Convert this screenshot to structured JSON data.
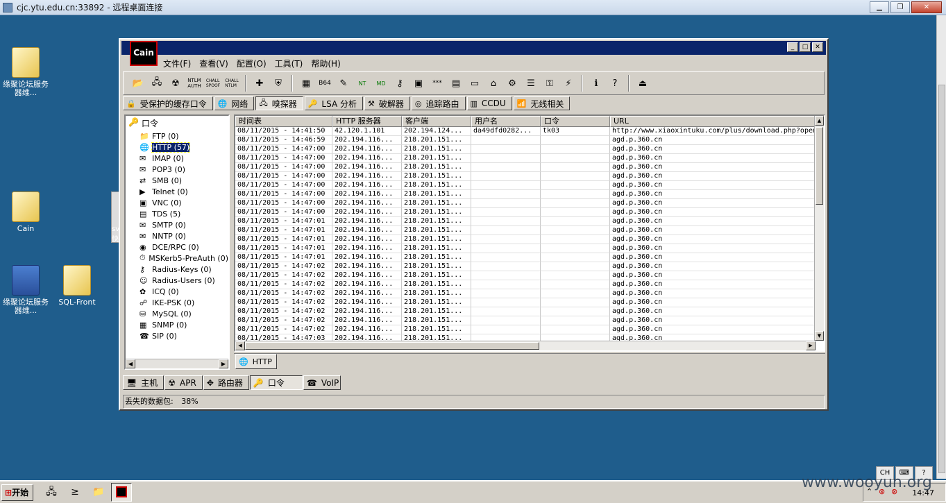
{
  "rdp": {
    "title": "cjc.ytu.edu.cn:33892 - 远程桌面连接"
  },
  "desktop": {
    "icons": [
      {
        "label": "缘聚论坛服务器维..."
      },
      {
        "label": "Cain"
      },
      {
        "label": "缘聚论坛服务器维..."
      },
      {
        "label": "SQL-Front"
      }
    ],
    "partial_label": "sv\n快"
  },
  "cain": {
    "logo": "Cain",
    "menu": [
      "文件(F)",
      "查看(V)",
      "配置(O)",
      "工具(T)",
      "帮助(H)"
    ],
    "tabs": [
      "受保护的缓存口令",
      "网络",
      "嗅探器",
      "LSA 分析",
      "破解器",
      "追踪路由",
      "CCDU",
      "无线相关"
    ],
    "selected_tab": "嗅探器",
    "tree_root": "口令",
    "tree": [
      {
        "label": "FTP  (0)",
        "icon": "ftp-icon"
      },
      {
        "label": "HTTP (57)",
        "icon": "http-icon",
        "selected": true
      },
      {
        "label": "IMAP (0)",
        "icon": "imap-icon"
      },
      {
        "label": "POP3 (0)",
        "icon": "pop3-icon"
      },
      {
        "label": "SMB  (0)",
        "icon": "smb-icon"
      },
      {
        "label": "Telnet (0)",
        "icon": "telnet-icon"
      },
      {
        "label": "VNC  (0)",
        "icon": "vnc-icon"
      },
      {
        "label": "TDS  (5)",
        "icon": "tds-icon"
      },
      {
        "label": "SMTP (0)",
        "icon": "smtp-icon"
      },
      {
        "label": "NNTP (0)",
        "icon": "nntp-icon"
      },
      {
        "label": "DCE/RPC (0)",
        "icon": "dcerpc-icon"
      },
      {
        "label": "MSKerb5-PreAuth (0)",
        "icon": "kerberos-icon"
      },
      {
        "label": "Radius-Keys (0)",
        "icon": "radius-keys-icon"
      },
      {
        "label": "Radius-Users (0)",
        "icon": "radius-users-icon"
      },
      {
        "label": "ICQ  (0)",
        "icon": "icq-icon"
      },
      {
        "label": "IKE-PSK (0)",
        "icon": "ike-icon"
      },
      {
        "label": "MySQL (0)",
        "icon": "mysql-icon"
      },
      {
        "label": "SNMP (0)",
        "icon": "snmp-icon"
      },
      {
        "label": "SIP  (0)",
        "icon": "sip-icon"
      }
    ],
    "columns": [
      "时间表",
      "HTTP 服务器",
      "客户端",
      "用户名",
      "口令",
      "URL"
    ],
    "rows": [
      [
        "08/11/2015 - 14:41:50",
        "42.120.1.101",
        "202.194.124...",
        "da49dfd0282...",
        "tk03",
        "http://www.xiaoxintuku.com/plus/download.php?open"
      ],
      [
        "08/11/2015 - 14:46:59",
        "202.194.116...",
        "218.201.151...",
        "",
        "",
        "agd.p.360.cn"
      ],
      [
        "08/11/2015 - 14:47:00",
        "202.194.116...",
        "218.201.151...",
        "",
        "",
        "agd.p.360.cn"
      ],
      [
        "08/11/2015 - 14:47:00",
        "202.194.116...",
        "218.201.151...",
        "",
        "",
        "agd.p.360.cn"
      ],
      [
        "08/11/2015 - 14:47:00",
        "202.194.116...",
        "218.201.151...",
        "",
        "",
        "agd.p.360.cn"
      ],
      [
        "08/11/2015 - 14:47:00",
        "202.194.116...",
        "218.201.151...",
        "",
        "",
        "agd.p.360.cn"
      ],
      [
        "08/11/2015 - 14:47:00",
        "202.194.116...",
        "218.201.151...",
        "",
        "",
        "agd.p.360.cn"
      ],
      [
        "08/11/2015 - 14:47:00",
        "202.194.116...",
        "218.201.151...",
        "",
        "",
        "agd.p.360.cn"
      ],
      [
        "08/11/2015 - 14:47:00",
        "202.194.116...",
        "218.201.151...",
        "",
        "",
        "agd.p.360.cn"
      ],
      [
        "08/11/2015 - 14:47:00",
        "202.194.116...",
        "218.201.151...",
        "",
        "",
        "agd.p.360.cn"
      ],
      [
        "08/11/2015 - 14:47:01",
        "202.194.116...",
        "218.201.151...",
        "",
        "",
        "agd.p.360.cn"
      ],
      [
        "08/11/2015 - 14:47:01",
        "202.194.116...",
        "218.201.151...",
        "",
        "",
        "agd.p.360.cn"
      ],
      [
        "08/11/2015 - 14:47:01",
        "202.194.116...",
        "218.201.151...",
        "",
        "",
        "agd.p.360.cn"
      ],
      [
        "08/11/2015 - 14:47:01",
        "202.194.116...",
        "218.201.151...",
        "",
        "",
        "agd.p.360.cn"
      ],
      [
        "08/11/2015 - 14:47:01",
        "202.194.116...",
        "218.201.151...",
        "",
        "",
        "agd.p.360.cn"
      ],
      [
        "08/11/2015 - 14:47:02",
        "202.194.116...",
        "218.201.151...",
        "",
        "",
        "agd.p.360.cn"
      ],
      [
        "08/11/2015 - 14:47:02",
        "202.194.116...",
        "218.201.151...",
        "",
        "",
        "agd.p.360.cn"
      ],
      [
        "08/11/2015 - 14:47:02",
        "202.194.116...",
        "218.201.151...",
        "",
        "",
        "agd.p.360.cn"
      ],
      [
        "08/11/2015 - 14:47:02",
        "202.194.116...",
        "218.201.151...",
        "",
        "",
        "agd.p.360.cn"
      ],
      [
        "08/11/2015 - 14:47:02",
        "202.194.116...",
        "218.201.151...",
        "",
        "",
        "agd.p.360.cn"
      ],
      [
        "08/11/2015 - 14:47:02",
        "202.194.116...",
        "218.201.151...",
        "",
        "",
        "agd.p.360.cn"
      ],
      [
        "08/11/2015 - 14:47:02",
        "202.194.116...",
        "218.201.151...",
        "",
        "",
        "agd.p.360.cn"
      ],
      [
        "08/11/2015 - 14:47:02",
        "202.194.116...",
        "218.201.151...",
        "",
        "",
        "agd.p.360.cn"
      ],
      [
        "08/11/2015 - 14:47:03",
        "202.194.116...",
        "218.201.151...",
        "",
        "",
        "agd.p.360.cn"
      ]
    ],
    "subtab": "HTTP",
    "bottom_tabs": [
      "主机",
      "APR",
      "路由器",
      "口令",
      "VoIP"
    ],
    "status_label": "丢失的数据包:",
    "status_value": "38%"
  },
  "taskbar": {
    "start": "开始",
    "clock": "14:47",
    "ime": "CH"
  },
  "watermark": "www.wooyun.org"
}
